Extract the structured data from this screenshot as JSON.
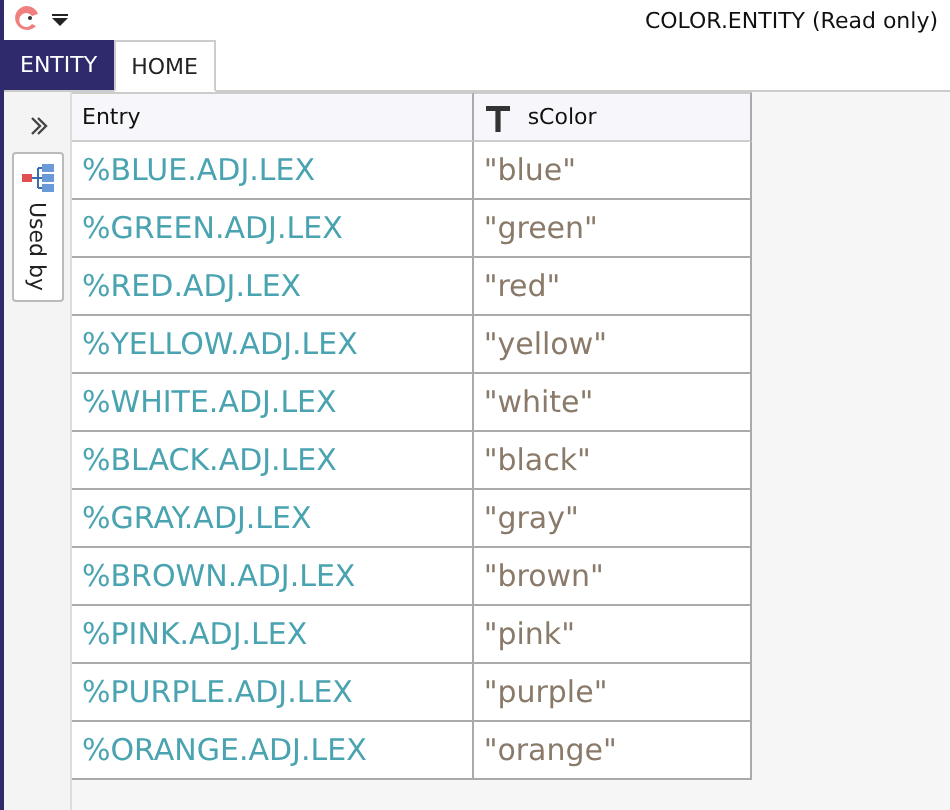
{
  "window": {
    "title": "COLOR.ENTITY (Read only)"
  },
  "tabs": [
    {
      "label": "ENTITY",
      "kind": "file",
      "selected": false
    },
    {
      "label": "HOME",
      "kind": "tab",
      "selected": true
    }
  ],
  "side_panel": {
    "tab_label": "Used by"
  },
  "table": {
    "columns": [
      "Entry",
      "sColor"
    ],
    "rows": [
      [
        "%BLUE.ADJ.LEX",
        "\"blue\""
      ],
      [
        "%GREEN.ADJ.LEX",
        "\"green\""
      ],
      [
        "%RED.ADJ.LEX",
        "\"red\""
      ],
      [
        "%YELLOW.ADJ.LEX",
        "\"yellow\""
      ],
      [
        "%WHITE.ADJ.LEX",
        "\"white\""
      ],
      [
        "%BLACK.ADJ.LEX",
        "\"black\""
      ],
      [
        "%GRAY.ADJ.LEX",
        "\"gray\""
      ],
      [
        "%BROWN.ADJ.LEX",
        "\"brown\""
      ],
      [
        "%PINK.ADJ.LEX",
        "\"pink\""
      ],
      [
        "%PURPLE.ADJ.LEX",
        "\"purple\""
      ],
      [
        "%ORANGE.ADJ.LEX",
        "\"orange\""
      ]
    ]
  }
}
